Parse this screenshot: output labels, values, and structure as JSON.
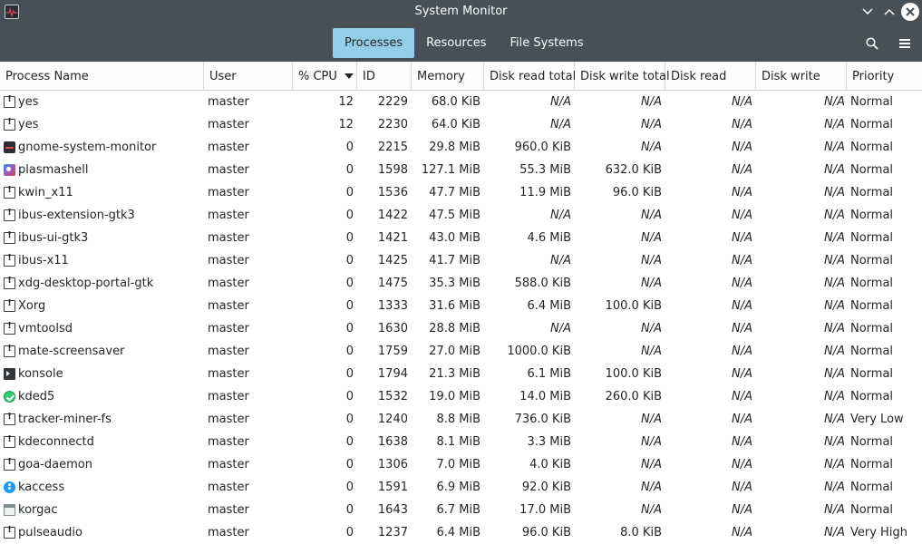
{
  "window": {
    "title": "System Monitor"
  },
  "tabs": [
    {
      "label": "Processes",
      "active": true
    },
    {
      "label": "Resources",
      "active": false
    },
    {
      "label": "File Systems",
      "active": false
    }
  ],
  "toolbar": {
    "search_icon": "search-icon",
    "menu_icon": "hamburger-menu-icon"
  },
  "columns": [
    "Process Name",
    "User",
    "% CPU",
    "ID",
    "Memory",
    "Disk read total",
    "Disk write total",
    "Disk read",
    "Disk write",
    "Priority"
  ],
  "sorted_column": "% CPU",
  "processes": [
    {
      "icon": "generic",
      "name": "yes",
      "user": "master",
      "cpu": "12",
      "id": "2229",
      "memory": "68.0 KiB",
      "disk_read_total": "N/A",
      "disk_write_total": "N/A",
      "disk_read": "N/A",
      "disk_write": "N/A",
      "priority": "Normal"
    },
    {
      "icon": "generic",
      "name": "yes",
      "user": "master",
      "cpu": "12",
      "id": "2230",
      "memory": "64.0 KiB",
      "disk_read_total": "N/A",
      "disk_write_total": "N/A",
      "disk_read": "N/A",
      "disk_write": "N/A",
      "priority": "Normal"
    },
    {
      "icon": "monitor",
      "name": "gnome-system-monitor",
      "user": "master",
      "cpu": "0",
      "id": "2215",
      "memory": "29.8 MiB",
      "disk_read_total": "960.0 KiB",
      "disk_write_total": "N/A",
      "disk_read": "N/A",
      "disk_write": "N/A",
      "priority": "Normal"
    },
    {
      "icon": "plasma",
      "name": "plasmashell",
      "user": "master",
      "cpu": "0",
      "id": "1598",
      "memory": "127.1 MiB",
      "disk_read_total": "55.3 MiB",
      "disk_write_total": "632.0 KiB",
      "disk_read": "N/A",
      "disk_write": "N/A",
      "priority": "Normal"
    },
    {
      "icon": "generic",
      "name": "kwin_x11",
      "user": "master",
      "cpu": "0",
      "id": "1536",
      "memory": "47.7 MiB",
      "disk_read_total": "11.9 MiB",
      "disk_write_total": "96.0 KiB",
      "disk_read": "N/A",
      "disk_write": "N/A",
      "priority": "Normal"
    },
    {
      "icon": "generic",
      "name": "ibus-extension-gtk3",
      "user": "master",
      "cpu": "0",
      "id": "1422",
      "memory": "47.5 MiB",
      "disk_read_total": "N/A",
      "disk_write_total": "N/A",
      "disk_read": "N/A",
      "disk_write": "N/A",
      "priority": "Normal"
    },
    {
      "icon": "generic",
      "name": "ibus-ui-gtk3",
      "user": "master",
      "cpu": "0",
      "id": "1421",
      "memory": "43.0 MiB",
      "disk_read_total": "4.6 MiB",
      "disk_write_total": "N/A",
      "disk_read": "N/A",
      "disk_write": "N/A",
      "priority": "Normal"
    },
    {
      "icon": "generic",
      "name": "ibus-x11",
      "user": "master",
      "cpu": "0",
      "id": "1425",
      "memory": "41.7 MiB",
      "disk_read_total": "N/A",
      "disk_write_total": "N/A",
      "disk_read": "N/A",
      "disk_write": "N/A",
      "priority": "Normal"
    },
    {
      "icon": "generic",
      "name": "xdg-desktop-portal-gtk",
      "user": "master",
      "cpu": "0",
      "id": "1475",
      "memory": "35.3 MiB",
      "disk_read_total": "588.0 KiB",
      "disk_write_total": "N/A",
      "disk_read": "N/A",
      "disk_write": "N/A",
      "priority": "Normal"
    },
    {
      "icon": "generic",
      "name": "Xorg",
      "user": "master",
      "cpu": "0",
      "id": "1333",
      "memory": "31.6 MiB",
      "disk_read_total": "6.4 MiB",
      "disk_write_total": "100.0 KiB",
      "disk_read": "N/A",
      "disk_write": "N/A",
      "priority": "Normal"
    },
    {
      "icon": "generic",
      "name": "vmtoolsd",
      "user": "master",
      "cpu": "0",
      "id": "1630",
      "memory": "28.8 MiB",
      "disk_read_total": "N/A",
      "disk_write_total": "N/A",
      "disk_read": "N/A",
      "disk_write": "N/A",
      "priority": "Normal"
    },
    {
      "icon": "generic",
      "name": "mate-screensaver",
      "user": "master",
      "cpu": "0",
      "id": "1759",
      "memory": "27.0 MiB",
      "disk_read_total": "1000.0 KiB",
      "disk_write_total": "N/A",
      "disk_read": "N/A",
      "disk_write": "N/A",
      "priority": "Normal"
    },
    {
      "icon": "konsole",
      "name": "konsole",
      "user": "master",
      "cpu": "0",
      "id": "1794",
      "memory": "21.3 MiB",
      "disk_read_total": "6.1 MiB",
      "disk_write_total": "100.0 KiB",
      "disk_read": "N/A",
      "disk_write": "N/A",
      "priority": "Normal"
    },
    {
      "icon": "kded",
      "name": "kded5",
      "user": "master",
      "cpu": "0",
      "id": "1532",
      "memory": "19.0 MiB",
      "disk_read_total": "14.0 MiB",
      "disk_write_total": "260.0 KiB",
      "disk_read": "N/A",
      "disk_write": "N/A",
      "priority": "Normal"
    },
    {
      "icon": "generic",
      "name": "tracker-miner-fs",
      "user": "master",
      "cpu": "0",
      "id": "1240",
      "memory": "8.8 MiB",
      "disk_read_total": "736.0 KiB",
      "disk_write_total": "N/A",
      "disk_read": "N/A",
      "disk_write": "N/A",
      "priority": "Very Low"
    },
    {
      "icon": "generic",
      "name": "kdeconnectd",
      "user": "master",
      "cpu": "0",
      "id": "1638",
      "memory": "8.1 MiB",
      "disk_read_total": "3.3 MiB",
      "disk_write_total": "N/A",
      "disk_read": "N/A",
      "disk_write": "N/A",
      "priority": "Normal"
    },
    {
      "icon": "generic",
      "name": "goa-daemon",
      "user": "master",
      "cpu": "0",
      "id": "1306",
      "memory": "7.0 MiB",
      "disk_read_total": "4.0 KiB",
      "disk_write_total": "N/A",
      "disk_read": "N/A",
      "disk_write": "N/A",
      "priority": "Normal"
    },
    {
      "icon": "kaccess",
      "name": "kaccess",
      "user": "master",
      "cpu": "0",
      "id": "1591",
      "memory": "6.9 MiB",
      "disk_read_total": "92.0 KiB",
      "disk_write_total": "N/A",
      "disk_read": "N/A",
      "disk_write": "N/A",
      "priority": "Normal"
    },
    {
      "icon": "korgac",
      "name": "korgac",
      "user": "master",
      "cpu": "0",
      "id": "1643",
      "memory": "6.7 MiB",
      "disk_read_total": "17.0 MiB",
      "disk_write_total": "N/A",
      "disk_read": "N/A",
      "disk_write": "N/A",
      "priority": "Normal"
    },
    {
      "icon": "generic",
      "name": "pulseaudio",
      "user": "master",
      "cpu": "0",
      "id": "1237",
      "memory": "6.4 MiB",
      "disk_read_total": "96.0 KiB",
      "disk_write_total": "8.0 KiB",
      "disk_read": "N/A",
      "disk_write": "N/A",
      "priority": "Very High"
    }
  ]
}
